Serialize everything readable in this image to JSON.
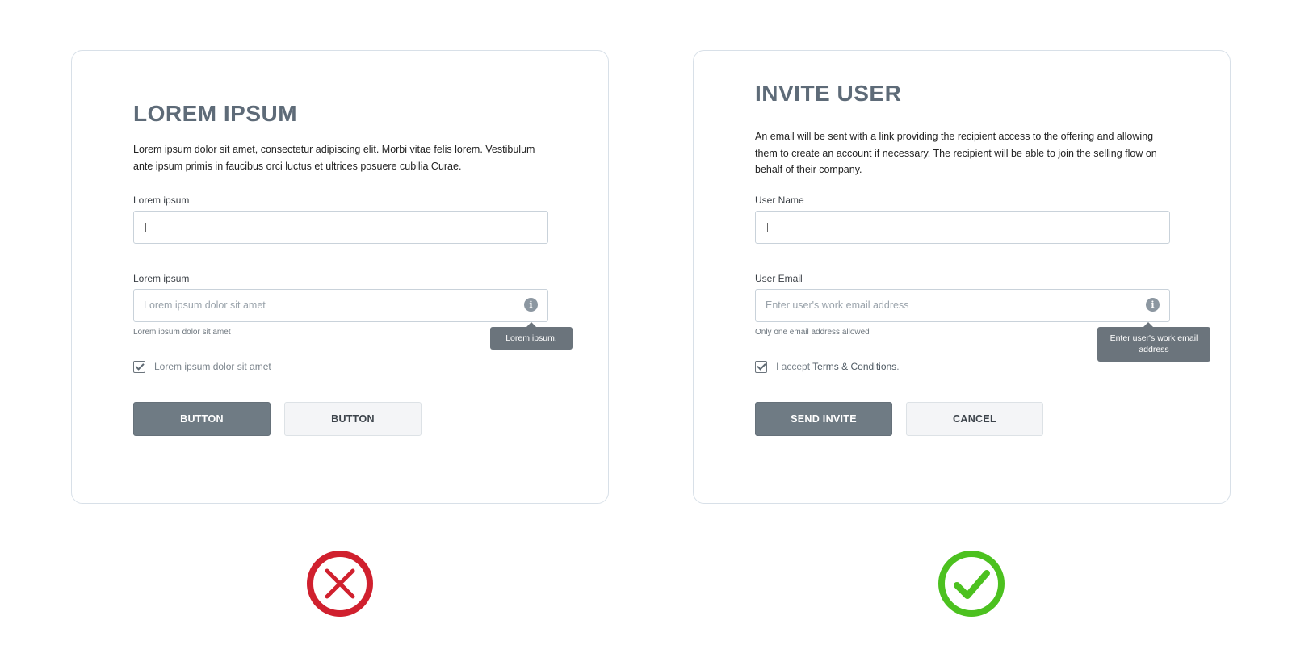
{
  "bad_example": {
    "title": "LOREM IPSUM",
    "description": "Lorem ipsum dolor sit amet, consectetur adipiscing elit. Morbi vitae felis lorem. Vestibulum ante ipsum primis in faucibus orci luctus et ultrices posuere cubilia Curae.",
    "field1": {
      "label": "Lorem ipsum",
      "value": "",
      "placeholder": ""
    },
    "field2": {
      "label": "Lorem ipsum",
      "placeholder": "Lorem ipsum dolor sit amet",
      "helper": "Lorem ipsum dolor sit amet",
      "tooltip": "Lorem ipsum."
    },
    "checkbox": {
      "label": "Lorem ipsum dolor sit amet",
      "checked": true
    },
    "primary_button": "BUTTON",
    "secondary_button": "BUTTON",
    "verdict_icon": "x-circle-icon",
    "verdict_color": "#d0202e"
  },
  "good_example": {
    "title": "INVITE USER",
    "description": "An email will be sent with a link providing the recipient access to the offering and allowing them to create an account if necessary. The recipient will be able to join the selling flow on behalf of their company.",
    "field1": {
      "label": "User Name",
      "value": "",
      "placeholder": ""
    },
    "field2": {
      "label": "User Email",
      "placeholder": "Enter user's work email address",
      "helper": "Only one email address allowed",
      "tooltip": "Enter user's work email address"
    },
    "checkbox": {
      "prefix": "I accept ",
      "link": "Terms & Conditions",
      "suffix": ".",
      "checked": true
    },
    "primary_button": "SEND INVITE",
    "secondary_button": "CANCEL",
    "verdict_icon": "check-circle-icon",
    "verdict_color": "#4cc11f"
  },
  "colors": {
    "card_border": "#d8e0e8",
    "title": "#5e6b78",
    "primary_button_bg": "#6f7b84",
    "tooltip_bg": "#6b747c"
  }
}
